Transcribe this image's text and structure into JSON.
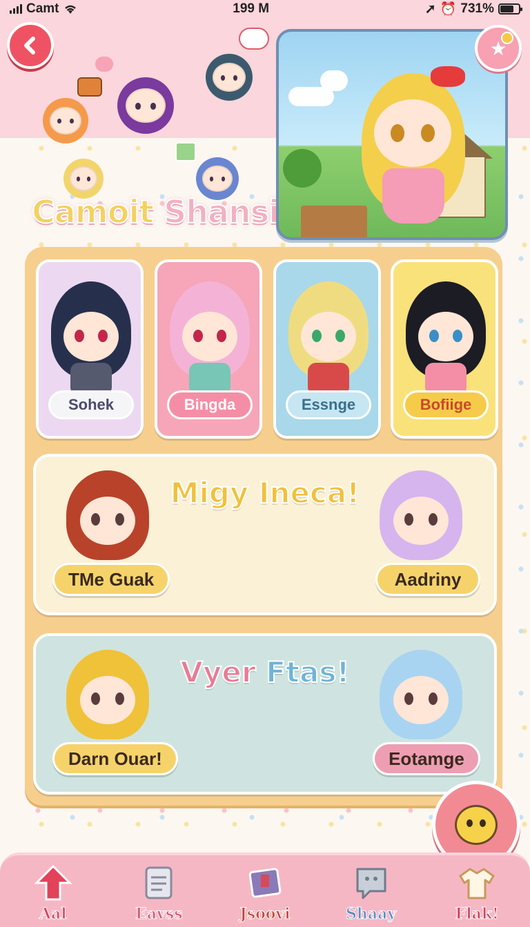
{
  "status_bar": {
    "carrier": "Camt",
    "time": "199 M",
    "battery": "731%",
    "battery_level": 0.73
  },
  "header": {
    "back_icon": "chevron-left-icon",
    "title_part1": "Camoit",
    "title_part2": "Shansis",
    "badge_icon": "star-icon"
  },
  "characters": [
    {
      "name": "Sohek",
      "card_color": "#ecd9f1",
      "hair_color": "#26304d",
      "pill_color": "#f5f5f8",
      "text_color": "#4a4a6a",
      "eye_color": "#c2264b",
      "body_color": "#565a6e"
    },
    {
      "name": "Bingda",
      "card_color": "#f6a6b8",
      "hair_color": "#f4b3d6",
      "pill_color": "#f48ea6",
      "text_color": "#ffffff",
      "eye_color": "#c2264b",
      "body_color": "#78c6b5"
    },
    {
      "name": "Essnge",
      "card_color": "#a8d8ea",
      "hair_color": "#f0dc80",
      "pill_color": "#c6e6f2",
      "text_color": "#3a6f8a",
      "eye_color": "#3aa86a",
      "body_color": "#d84a4a"
    },
    {
      "name": "Bofiige",
      "card_color": "#f9e27a",
      "hair_color": "#1c1c24",
      "pill_color": "#f6cb4a",
      "text_color": "#c84a2a",
      "eye_color": "#3a8ec8",
      "body_color": "#f48ea6"
    }
  ],
  "banners": [
    {
      "title": "Migy Ineca!",
      "title_color": "#f1c13c",
      "bg_color": "#fbf1d6",
      "left_button": "TMe Guak",
      "right_button": "Aadriny",
      "left_btn_color": "#f6d36a",
      "right_btn_color": "#f6d36a",
      "left_hair": "#b8432a",
      "right_hair": "#d6b4ee"
    },
    {
      "title_part1": "Vyer",
      "title_part2": "Ftas!",
      "title_color1": "#ea7b94",
      "title_color2": "#6fb4d8",
      "bg_color": "#cfe4e0",
      "left_button": "Darn Ouar!",
      "right_button": "Eotamge",
      "left_btn_color": "#f6d36a",
      "right_btn_color": "#ee9eb2",
      "left_hair": "#f0c23a",
      "right_hair": "#a8d4f2"
    }
  ],
  "fab": {
    "icon": "bee-face-icon"
  },
  "bottom_nav": [
    {
      "label": "Aal",
      "icon": "home-arrow-icon",
      "color": "#e2425a"
    },
    {
      "label": "Eavss",
      "icon": "document-icon",
      "color": "#d45a72"
    },
    {
      "label": "Jsoovi",
      "icon": "photo-icon",
      "color": "#c24a3a"
    },
    {
      "label": "Shaay",
      "icon": "chat-bubble-icon",
      "color": "#5a8ec2"
    },
    {
      "label": "Flak!",
      "icon": "shirt-icon",
      "color": "#d4405a"
    }
  ]
}
